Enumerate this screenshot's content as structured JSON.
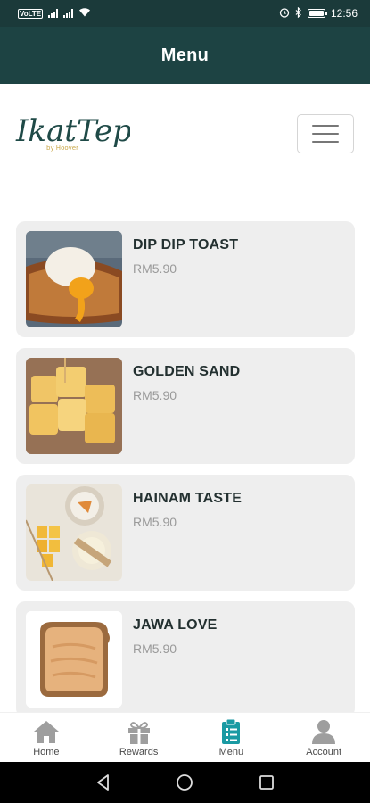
{
  "status_bar": {
    "network": "4G",
    "time": "12:56"
  },
  "header": {
    "title": "Menu"
  },
  "brand": {
    "logo_text": "IkatTepi",
    "logo_subtext": "by Hoover"
  },
  "menu_items": [
    {
      "name": "DIP DIP TOAST",
      "price": "RM5.90",
      "image": "poached-egg-toast-photo"
    },
    {
      "name": "GOLDEN SAND",
      "price": "RM5.90",
      "image": "golden-toast-cubes-photo"
    },
    {
      "name": "HAINAM TASTE",
      "price": "RM5.90",
      "image": "hainan-toast-coffee-photo"
    },
    {
      "name": "JAWA LOVE",
      "price": "RM5.90",
      "image": "peanut-butter-toast-photo"
    }
  ],
  "bottom_nav": [
    {
      "label": "Home",
      "icon": "home-icon",
      "active": false
    },
    {
      "label": "Rewards",
      "icon": "gift-icon",
      "active": false
    },
    {
      "label": "Menu",
      "icon": "clipboard-list-icon",
      "active": true
    },
    {
      "label": "Account",
      "icon": "user-icon",
      "active": false
    }
  ],
  "colors": {
    "header_bg": "#1d4343",
    "status_bg": "#1b3a3a",
    "card_bg": "#eeeeee",
    "active_nav": "#1a9aa3",
    "inactive_nav": "#9e9e9e"
  }
}
